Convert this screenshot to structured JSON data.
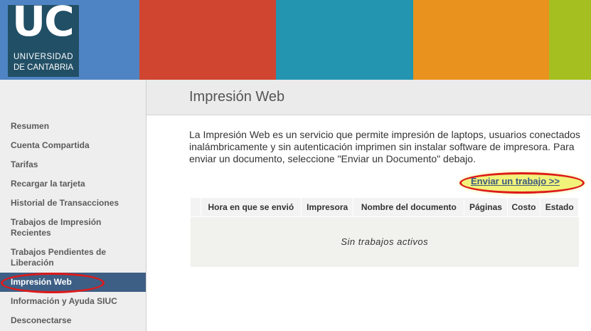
{
  "header": {
    "logo_mark": "UC",
    "logo_line1": "UNIVERSIDAD",
    "logo_line2": "DE CANTABRIA",
    "stripe_colors": [
      "#4f84c4",
      "#cf4530",
      "#2395b0",
      "#e9921e",
      "#a6bf20"
    ]
  },
  "sidebar": {
    "items": [
      {
        "label": "Resumen"
      },
      {
        "label": "Cuenta Compartida"
      },
      {
        "label": "Tarifas"
      },
      {
        "label": "Recargar la tarjeta"
      },
      {
        "label": "Historial de Transacciones"
      },
      {
        "label": "Trabajos de Impresión Recientes"
      },
      {
        "label": "Trabajos Pendientes de Liberación"
      },
      {
        "label": "Impresión Web",
        "active": true
      },
      {
        "label": "Información y Ayuda SIUC"
      },
      {
        "label": "Desconectarse"
      }
    ]
  },
  "main": {
    "title": "Impresión Web",
    "intro": "La Impresión Web es un servicio que permite impresión de laptops, usuarios conectados inalámbricamente y sin autenticación imprimen sin instalar software de impresora. Para enviar un documento, seleccione \"Enviar un Documento\" debajo.",
    "send_link": "Enviar un trabajo >>",
    "table": {
      "columns": [
        "",
        "Hora en que se envió",
        "Impresora",
        "Nombre del documento",
        "Páginas",
        "Costo",
        "Estado"
      ],
      "empty_text": "Sin trabajos activos"
    }
  },
  "colors": {
    "nav_active_bg": "#3e5f85",
    "annotation_red": "#dd1a1a",
    "highlight_yellow": "#f1f27a",
    "link_color": "#3d5a80"
  }
}
